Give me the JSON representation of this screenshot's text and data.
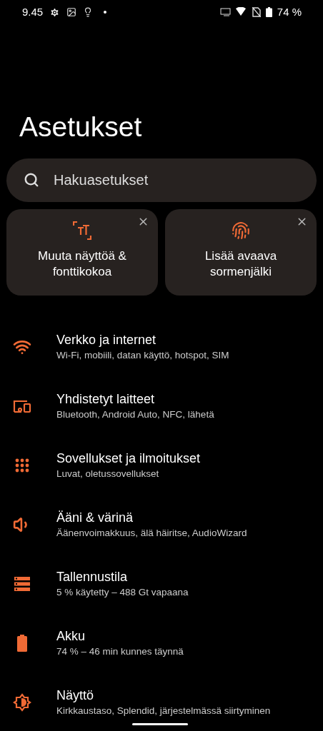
{
  "status_bar": {
    "time": "9.45",
    "battery": "74 %"
  },
  "title": "Asetukset",
  "search": {
    "placeholder": "Hakuasetukset"
  },
  "suggestions": [
    {
      "kind": "text-size",
      "label": "Muuta näyttöä & fonttikokoa"
    },
    {
      "kind": "fingerprint",
      "label": "Lisää avaava sormenjälki"
    }
  ],
  "items": [
    {
      "kind": "wifi",
      "title": "Verkko ja internet",
      "subtitle": "Wi-Fi, mobiili, datan käyttö, hotspot, SIM"
    },
    {
      "kind": "devices",
      "title": "Yhdistetyt laitteet",
      "subtitle": "Bluetooth, Android Auto, NFC, lähetä"
    },
    {
      "kind": "apps",
      "title": "Sovellukset ja ilmoitukset",
      "subtitle": "Luvat, oletussovellukset"
    },
    {
      "kind": "sound",
      "title": "Ääni & värinä",
      "subtitle": "Äänenvoimakkuus, älä häiritse, AudioWizard"
    },
    {
      "kind": "storage",
      "title": "Tallennustila",
      "subtitle": "5 % käytetty – 488 Gt vapaana"
    },
    {
      "kind": "battery",
      "title": "Akku",
      "subtitle": "74 % – 46 min kunnes täynnä"
    },
    {
      "kind": "display",
      "title": "Näyttö",
      "subtitle": "Kirkkaustaso, Splendid, järjestelmässä siirtyminen"
    }
  ]
}
